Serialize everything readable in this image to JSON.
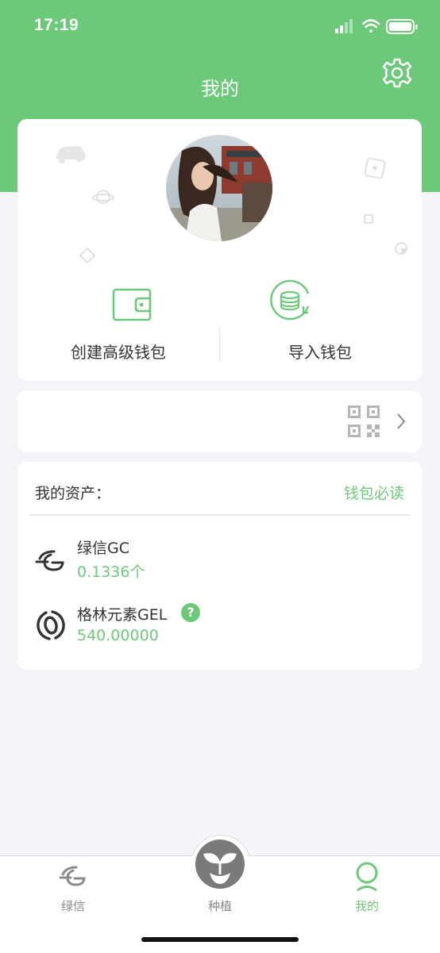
{
  "status_bar": {
    "time": "17:19"
  },
  "header": {
    "title": "我的"
  },
  "profile": {
    "actions": [
      {
        "label": "创建高级钱包",
        "icon": "wallet-icon"
      },
      {
        "label": "导入钱包",
        "icon": "coin-stack-import-icon"
      }
    ]
  },
  "qr_row": {
    "icon": "qr-code-icon"
  },
  "assets": {
    "title": "我的资产：",
    "link": "钱包必读",
    "items": [
      {
        "name": "绿信GC",
        "amount": "0.1336个",
        "icon": "gc-logo-icon"
      },
      {
        "name": "格林元素GEL",
        "amount": "540.00000",
        "icon": "gel-logo-icon",
        "help": "?"
      }
    ]
  },
  "tabbar": {
    "tabs": [
      {
        "label": "绿信",
        "icon": "greencredit-logo-icon",
        "active": false
      },
      {
        "label": "种植",
        "icon": "sprout-icon",
        "active": false
      },
      {
        "label": "我的",
        "icon": "person-icon",
        "active": true
      }
    ]
  },
  "colors": {
    "accent": "#6dc97a",
    "background": "#f4f4f9",
    "tab_inactive": "#8a8a8a"
  }
}
